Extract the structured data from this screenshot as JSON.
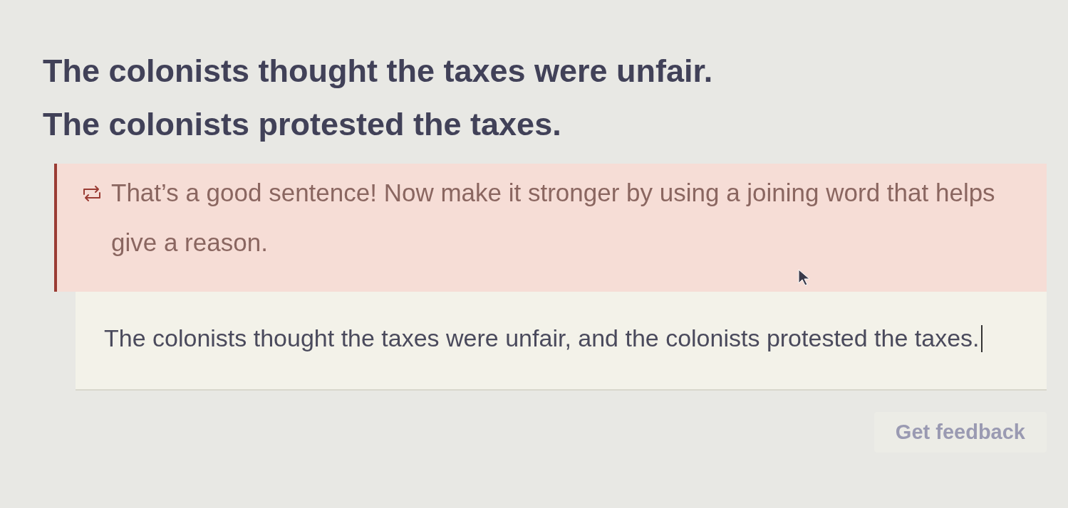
{
  "prompt": {
    "sentences": [
      "The colonists thought the taxes were unfair.",
      "The colonists protested the taxes."
    ]
  },
  "feedback": {
    "text": "That’s a good sentence! Now make it stronger by using a joining word that helps give a reason."
  },
  "answer": {
    "value": "The colonists thought the taxes were unfair, and the colonists protested the taxes."
  },
  "buttons": [
    "Get feedback"
  ]
}
